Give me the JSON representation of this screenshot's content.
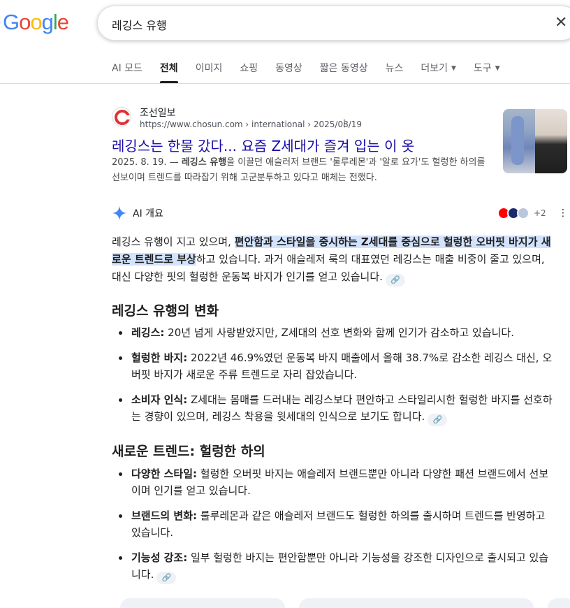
{
  "logo": {
    "letters": [
      "G",
      "o",
      "o",
      "g",
      "l",
      "e"
    ],
    "colors": [
      "#4285f4",
      "#ea4335",
      "#fbbc05",
      "#4285f4",
      "#34a853",
      "#ea4335"
    ]
  },
  "search": {
    "query": "레깅스 유행",
    "clear_icon": "close-icon"
  },
  "tabs": [
    {
      "label": "AI 모드"
    },
    {
      "label": "전체",
      "active": true
    },
    {
      "label": "이미지"
    },
    {
      "label": "쇼핑"
    },
    {
      "label": "동영상"
    },
    {
      "label": "짧은 동영상"
    },
    {
      "label": "뉴스"
    },
    {
      "label": "더보기",
      "dropdown": true
    },
    {
      "label": "도구",
      "dropdown": true
    }
  ],
  "result": {
    "site_name": "조선일보",
    "url": "https://www.chosun.com › international › 2025/08/19",
    "title": "레깅스는 한물 갔다... 요즘 Z세대가 즐겨 입는 이 옷",
    "snippet_date": "2025. 8. 19. — ",
    "snippet_bold": "레깅스 유행",
    "snippet_rest": "을 이끌던 애슬러저 브랜드 '룰루레몬'과 '알로 요가'도 헐렁한 하의를 선보이며 트렌드를 따라잡기 위해 고군분투하고 있다고 매체는 전했다."
  },
  "ai_overview": {
    "label": "AI 개요",
    "sources_more": "+2",
    "intro_start": "레깅스 유행이 지고 있으며, ",
    "intro_highlight": "편안함과 스타일을 중시하는 Z세대를 중심으로 헐렁한 오버핏 바지가 새로운 트렌드로 부상",
    "intro_end": "하고 있습니다. 과거 애슬레저 룩의 대표였던 레깅스는 매출 비중이 줄고 있으며, 대신 다양한 핏의 헐렁한 운동복 바지가 인기를 얻고 있습니다.",
    "section1": {
      "title": "레깅스 유행의 변화",
      "items": [
        {
          "bold": "레깅스:",
          "text": " 20년 넘게 사랑받았지만, Z세대의 선호 변화와 함께 인기가 감소하고 있습니다."
        },
        {
          "bold": "헐렁한 바지:",
          "text": " 2022년 46.9%였던 운동복 바지 매출에서 올해 38.7%로 감소한 레깅스 대신, 오버핏 바지가 새로운 주류 트렌드로 자리 잡았습니다."
        },
        {
          "bold": "소비자 인식:",
          "text": " Z세대는 몸매를 드러내는 레깅스보다 편안하고 스타일리시한 헐렁한 바지를 선호하는 경향이 있으며, 레깅스 착용을 윗세대의 인식으로 보기도 합니다."
        }
      ]
    },
    "section2": {
      "title": "새로운 트렌드: 헐렁한 하의",
      "items": [
        {
          "bold": "다양한 스타일:",
          "text": " 헐렁한 오버핏 바지는 애슬레저 브랜드뿐만 아니라 다양한 패션 브랜드에서 선보이며 인기를 얻고 있습니다."
        },
        {
          "bold": "브랜드의 변화:",
          "text": " 룰루레몬과 같은 애슬레저 브랜드도 헐렁한 하의를 출시하며 트렌드를 반영하고 있습니다."
        },
        {
          "bold": "기능성 강조:",
          "text": " 일부 헐렁한 바지는 편안함뿐만 아니라 기능성을 강조한 디자인으로 출시되고 있습니다."
        }
      ]
    }
  }
}
